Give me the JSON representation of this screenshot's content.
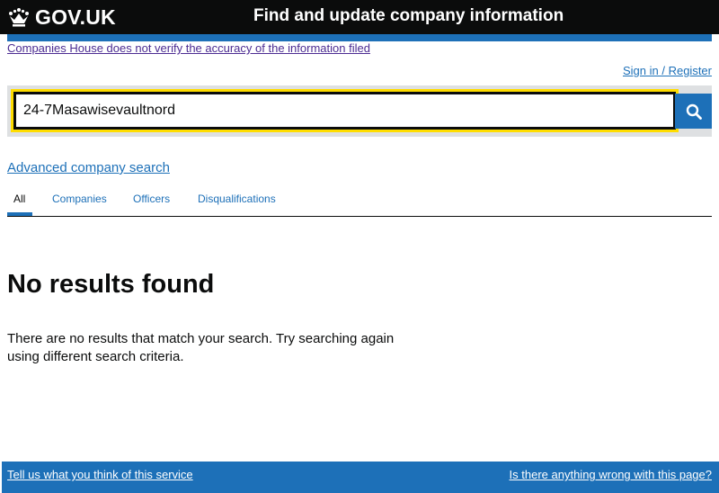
{
  "header": {
    "logo_text": "GOV.UK",
    "service_name": "Find and update company information"
  },
  "banner": {
    "disclaimer": "Companies House does not verify the accuracy of the information filed"
  },
  "account": {
    "sign_in": "Sign in / Register"
  },
  "search": {
    "value": "24-7Masawisevaultnord"
  },
  "links": {
    "advanced_search": "Advanced company search"
  },
  "tabs": [
    {
      "label": "All",
      "active": true
    },
    {
      "label": "Companies"
    },
    {
      "label": "Officers"
    },
    {
      "label": "Disqualifications"
    }
  ],
  "results": {
    "heading": "No results found",
    "message": "There are no results that match your search. Try searching again using different search criteria."
  },
  "footer": {
    "feedback": "Tell us what you think of this service",
    "report": "Is there anything wrong with this page?"
  },
  "colors": {
    "header_bg": "#0b0c0c",
    "brand_blue": "#1d70b8",
    "focus_yellow": "#ffdd00",
    "visited_link": "#4c2c92"
  }
}
